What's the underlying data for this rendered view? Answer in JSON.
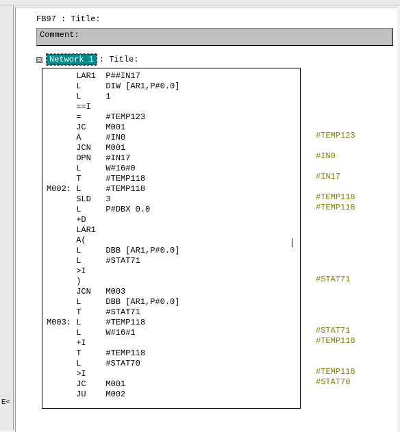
{
  "block_title": "FB97 : Title:",
  "comment_label": "Comment:",
  "network": {
    "toggle": "⊟",
    "label": "Network 1",
    "title_suffix": ": Title:"
  },
  "left_handle": "E<",
  "code": [
    {
      "l": "",
      "o": "LAR1",
      "a": "P##IN17",
      "ann": ""
    },
    {
      "l": "",
      "o": "L",
      "a": "DIW [AR1,P#0.0]",
      "ann": ""
    },
    {
      "l": "",
      "o": "L",
      "a": "1",
      "ann": ""
    },
    {
      "l": "",
      "o": "==I",
      "a": "",
      "ann": ""
    },
    {
      "l": "",
      "o": "=",
      "a": "#TEMP123",
      "ann": "#TEMP123"
    },
    {
      "l": "",
      "o": "JC",
      "a": "M001",
      "ann": ""
    },
    {
      "l": "",
      "o": "A",
      "a": "#IN0",
      "ann": "#IN0"
    },
    {
      "l": "",
      "o": "JCN",
      "a": "M001",
      "ann": ""
    },
    {
      "l": "",
      "o": "OPN",
      "a": "#IN17",
      "ann": "#IN17"
    },
    {
      "l": "",
      "o": "L",
      "a": "W#16#0",
      "ann": ""
    },
    {
      "l": "",
      "o": "T",
      "a": "#TEMP118",
      "ann": "#TEMP118"
    },
    {
      "l": "M002:",
      "o": "L",
      "a": "#TEMP118",
      "ann": "#TEMP118"
    },
    {
      "l": "",
      "o": "SLD",
      "a": "3",
      "ann": ""
    },
    {
      "l": "",
      "o": "L",
      "a": "P#DBX 0.0",
      "ann": ""
    },
    {
      "l": "",
      "o": "+D",
      "a": "",
      "ann": ""
    },
    {
      "l": "",
      "o": "LAR1",
      "a": "",
      "ann": ""
    },
    {
      "l": "",
      "o": "A(",
      "a": "",
      "ann": ""
    },
    {
      "l": "",
      "o": "L",
      "a": "DBB [AR1,P#0.0]",
      "ann": ""
    },
    {
      "l": "",
      "o": "L",
      "a": "#STAT71",
      "ann": "#STAT71"
    },
    {
      "l": "",
      "o": ">I",
      "a": "",
      "ann": ""
    },
    {
      "l": "",
      "o": ")",
      "a": "",
      "ann": ""
    },
    {
      "l": "",
      "o": "JCN",
      "a": "M003",
      "ann": ""
    },
    {
      "l": "",
      "o": "L",
      "a": "DBB [AR1,P#0.0]",
      "ann": ""
    },
    {
      "l": "",
      "o": "T",
      "a": "#STAT71",
      "ann": "#STAT71"
    },
    {
      "l": "M003:",
      "o": "L",
      "a": "#TEMP118",
      "ann": "#TEMP118"
    },
    {
      "l": "",
      "o": "L",
      "a": "W#16#1",
      "ann": ""
    },
    {
      "l": "",
      "o": "+I",
      "a": "",
      "ann": ""
    },
    {
      "l": "",
      "o": "T",
      "a": "#TEMP118",
      "ann": "#TEMP118"
    },
    {
      "l": "",
      "o": "L",
      "a": "#STAT70",
      "ann": "#STAT70"
    },
    {
      "l": "",
      "o": ">I",
      "a": "",
      "ann": ""
    },
    {
      "l": "",
      "o": "JC",
      "a": "M001",
      "ann": ""
    },
    {
      "l": "",
      "o": "JU",
      "a": "M002",
      "ann": ""
    }
  ]
}
